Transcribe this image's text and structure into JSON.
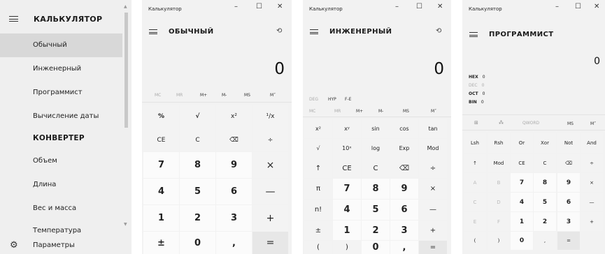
{
  "navigation": {
    "title": "КАЛЬКУЛЯТОР",
    "items": [
      {
        "label": "Обычный"
      },
      {
        "label": "Инженерный"
      },
      {
        "label": "Программист"
      },
      {
        "label": "Вычисление даты"
      }
    ],
    "converter_title": "КОНВЕРТЕР",
    "converter_items": [
      {
        "label": "Объем"
      },
      {
        "label": "Длина"
      },
      {
        "label": "Вес и масса"
      },
      {
        "label": "Температура"
      }
    ],
    "footer": "Параметры"
  },
  "standard": {
    "window_title": "Калькулятор",
    "minimize": "–",
    "maximize": "☐",
    "close": "✕",
    "mode": "ОБЫЧНЫЙ",
    "display": "0",
    "memory": [
      "MC",
      "MR",
      "M+",
      "M-",
      "MS",
      "M˅"
    ],
    "keys": [
      [
        "%",
        "√",
        "x²",
        "¹/x"
      ],
      [
        "CE",
        "C",
        "⌫",
        "÷"
      ],
      [
        "7",
        "8",
        "9",
        "×"
      ],
      [
        "4",
        "5",
        "6",
        "—"
      ],
      [
        "1",
        "2",
        "3",
        "+"
      ],
      [
        "±",
        "0",
        ",",
        "="
      ]
    ]
  },
  "scientific": {
    "window_title": "Калькулятор",
    "minimize": "–",
    "maximize": "☐",
    "close": "✕",
    "mode": "ИНЖЕНЕРНЫЙ",
    "display": "0",
    "toggles": [
      "DEG",
      "HYP",
      "F-E"
    ],
    "memory": [
      "MC",
      "MR",
      "M+",
      "M-",
      "MS",
      "M˅"
    ],
    "keys": [
      [
        "x²",
        "xʸ",
        "sin",
        "cos",
        "tan"
      ],
      [
        "√",
        "10ˣ",
        "log",
        "Exp",
        "Mod"
      ],
      [
        "↑",
        "CE",
        "C",
        "⌫",
        "÷"
      ],
      [
        "π",
        "7",
        "8",
        "9",
        "×"
      ],
      [
        "n!",
        "4",
        "5",
        "6",
        "—"
      ],
      [
        "±",
        "1",
        "2",
        "3",
        "+"
      ],
      [
        "(",
        ")",
        "0",
        ",",
        "="
      ]
    ]
  },
  "programmer": {
    "window_title": "Калькулятор",
    "minimize": "–",
    "maximize": "☐",
    "close": "✕",
    "mode": "ПРОГРАММИСТ",
    "display": "0",
    "radix": [
      {
        "name": "HEX",
        "value": "0"
      },
      {
        "name": "DEC",
        "value": "0"
      },
      {
        "name": "OCT",
        "value": "0"
      },
      {
        "name": "BIN",
        "value": "0"
      }
    ],
    "word_size": "QWORD",
    "memory": [
      "MS",
      "M˅"
    ],
    "keys": [
      [
        "Lsh",
        "Rsh",
        "Or",
        "Xor",
        "Not",
        "And"
      ],
      [
        "↑",
        "Mod",
        "CE",
        "C",
        "⌫",
        "÷"
      ],
      [
        "A",
        "B",
        "7",
        "8",
        "9",
        "×"
      ],
      [
        "C",
        "D",
        "4",
        "5",
        "6",
        "—"
      ],
      [
        "E",
        "F",
        "1",
        "2",
        "3",
        "+"
      ],
      [
        "(",
        ")",
        "0",
        ",",
        "="
      ]
    ]
  }
}
